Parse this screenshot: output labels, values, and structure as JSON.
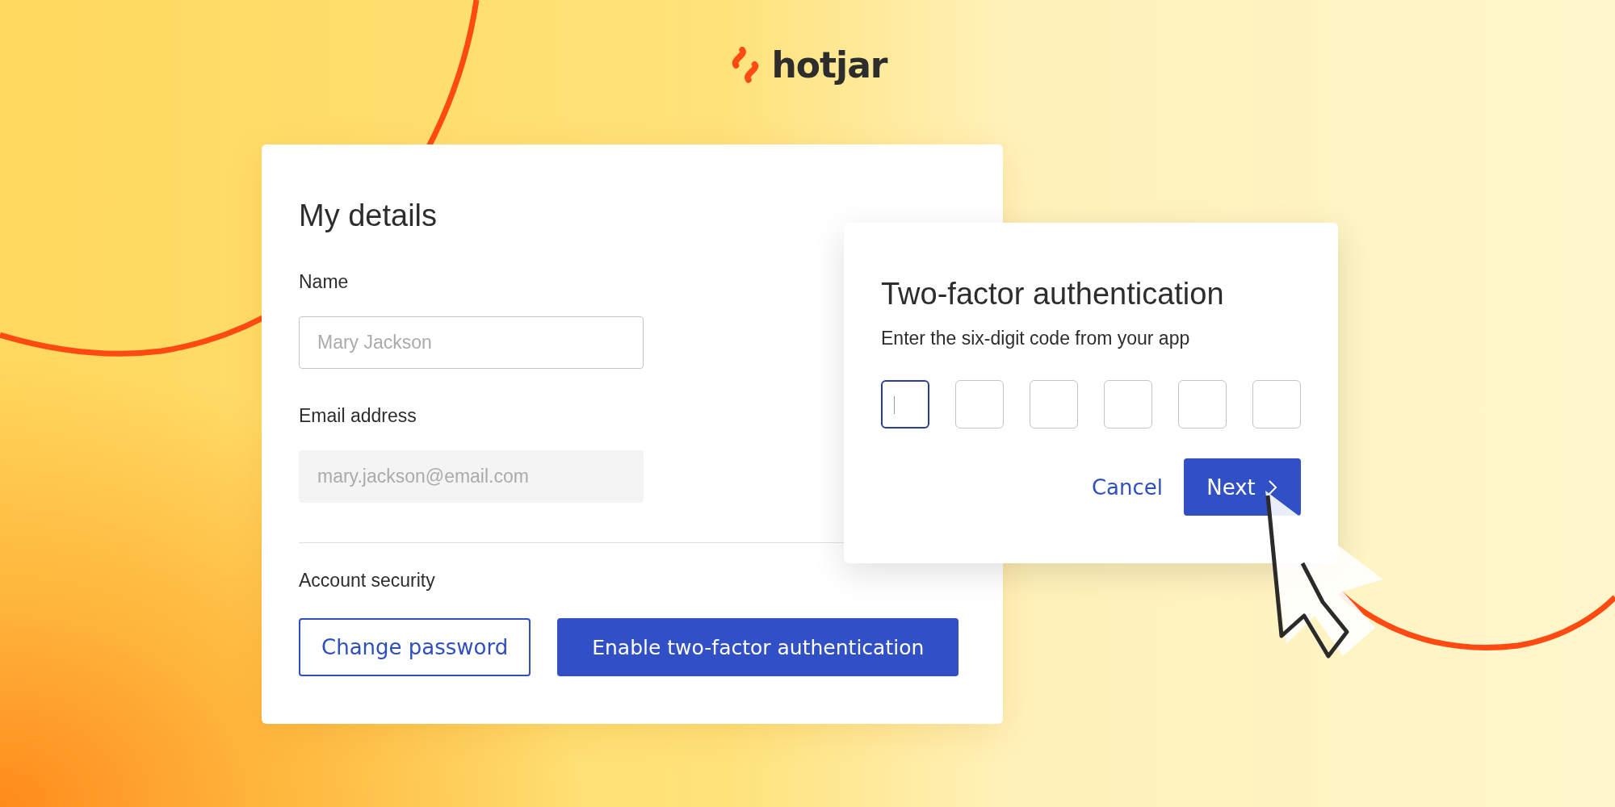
{
  "logo": {
    "text": "hotjar"
  },
  "details_card": {
    "title": "My details",
    "fields": [
      {
        "label": "Name",
        "placeholder": "Mary Jackson",
        "disabled": false
      },
      {
        "label": "Email address",
        "placeholder": "mary.jackson@email.com",
        "disabled": true
      }
    ],
    "section_title": "Account security",
    "buttons": [
      {
        "label": "Change password",
        "kind": "outline"
      },
      {
        "label": "Enable two-factor authentication",
        "kind": "primary"
      }
    ]
  },
  "two_factor_dialog": {
    "title": "Two-factor authentication",
    "instruction": "Enter the six-digit code from your app",
    "code_digits": [
      {
        "selected": true
      },
      {
        "selected": false
      },
      {
        "selected": false
      },
      {
        "selected": false
      },
      {
        "selected": false
      },
      {
        "selected": false
      }
    ],
    "buttons": [
      {
        "label": "Cancel",
        "kind": "link"
      },
      {
        "label": "Next",
        "kind": "primary"
      }
    ]
  }
}
